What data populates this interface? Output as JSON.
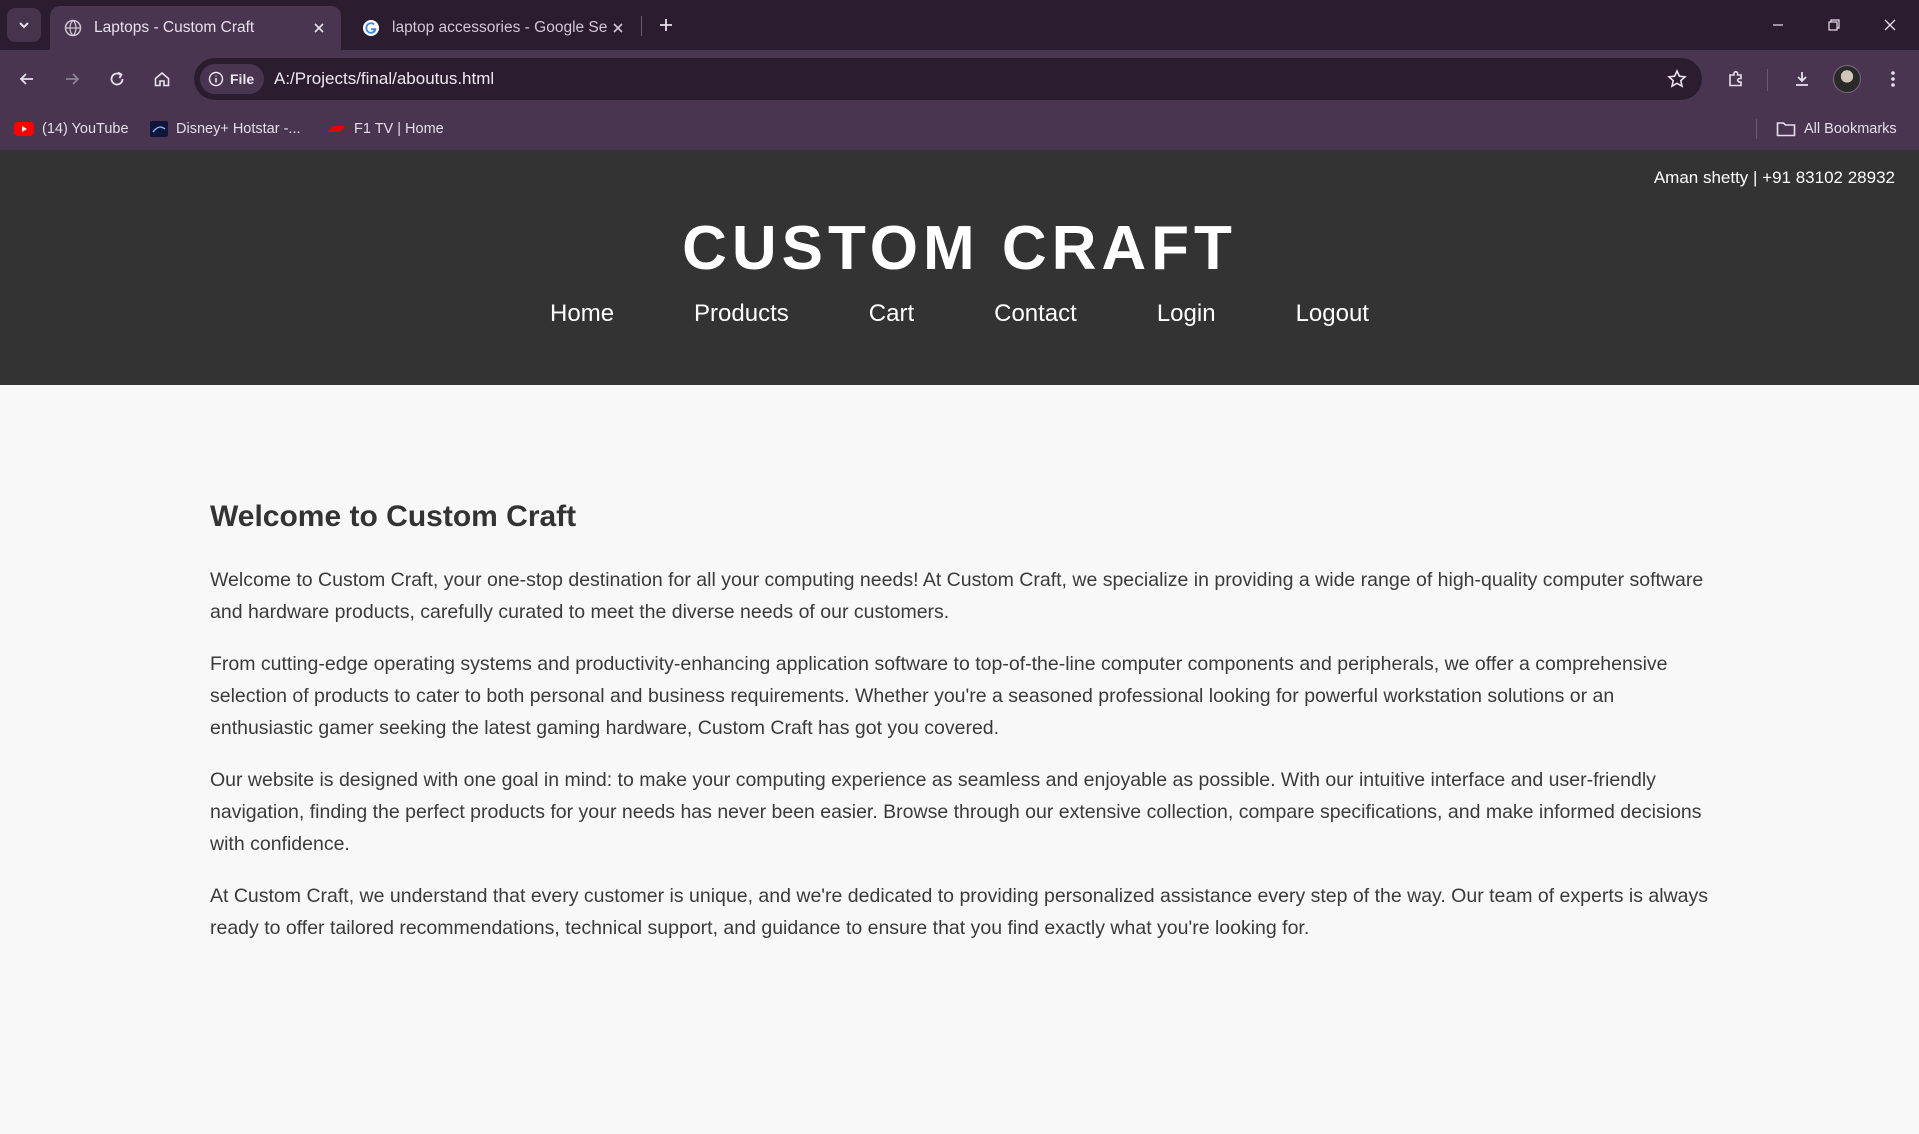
{
  "browser": {
    "tabs": [
      {
        "title": "Laptops - Custom Craft",
        "active": true,
        "favicon": "globe-icon"
      },
      {
        "title": "laptop accessories - Google Search",
        "active": false,
        "favicon": "google-icon"
      }
    ],
    "url": "A:/Projects/final/aboutus.html",
    "site_chip_label": "File",
    "bookmarks": [
      {
        "label": "(14) YouTube",
        "icon": "youtube-icon"
      },
      {
        "label": "Disney+ Hotstar -...",
        "icon": "hotstar-icon"
      },
      {
        "label": "F1 TV | Home",
        "icon": "f1-icon"
      }
    ],
    "all_bookmarks_label": "All Bookmarks",
    "colors": {
      "frame": "#2b1c30",
      "toolbar": "#4a3551"
    }
  },
  "site": {
    "contact": "Aman shetty | +91 83102 28932",
    "brand": "CUSTOM CRAFT",
    "nav": [
      "Home",
      "Products",
      "Cart",
      "Contact",
      "Login",
      "Logout"
    ],
    "colors": {
      "header_bg": "#333333",
      "page_bg": "#f8f8f8",
      "text": "#333333"
    }
  },
  "content": {
    "heading": "Welcome to Custom Craft",
    "paragraphs": [
      "Welcome to Custom Craft, your one-stop destination for all your computing needs! At Custom Craft, we specialize in providing a wide range of high-quality computer software and hardware products, carefully curated to meet the diverse needs of our customers.",
      "From cutting-edge operating systems and productivity-enhancing application software to top-of-the-line computer components and peripherals, we offer a comprehensive selection of products to cater to both personal and business requirements. Whether you're a seasoned professional looking for powerful workstation solutions or an enthusiastic gamer seeking the latest gaming hardware, Custom Craft has got you covered.",
      "Our website is designed with one goal in mind: to make your computing experience as seamless and enjoyable as possible. With our intuitive interface and user-friendly navigation, finding the perfect products for your needs has never been easier. Browse through our extensive collection, compare specifications, and make informed decisions with confidence.",
      "At Custom Craft, we understand that every customer is unique, and we're dedicated to providing personalized assistance every step of the way. Our team of experts is always ready to offer tailored recommendations, technical support, and guidance to ensure that you find exactly what you're looking for."
    ]
  }
}
